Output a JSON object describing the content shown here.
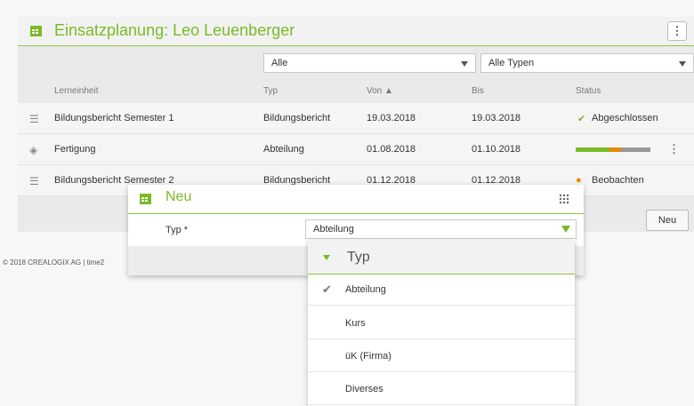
{
  "card": {
    "title": "Einsatzplanung: Leo Leuenberger",
    "menu_icon": "kebab-icon"
  },
  "filters": {
    "typ_filter": "Alle",
    "type_filter": "Alle Typen"
  },
  "columns": [
    "Lerneinheit",
    "Typ",
    "Von ▲",
    "Bis",
    "Status"
  ],
  "rows": [
    {
      "lerneinheit": "Bildungsbericht Semester 1",
      "typ": "Bildungsbericht",
      "von": "19.03.2018",
      "bis": "19.03.2018",
      "status": "Abgeschlossen"
    },
    {
      "lerneinheit": "Fertigung",
      "typ": "Abteilung",
      "von": "01.08.2018",
      "bis": "01.10.2018",
      "status": ""
    },
    {
      "lerneinheit": "Bildungsbericht Semester 2",
      "typ": "Bildungsbericht",
      "von": "01.12.2018",
      "bis": "01.12.2018",
      "status": "Beobachten"
    }
  ],
  "status_progress": {
    "complete": 0.45,
    "warning": 0.15,
    "remaining": 0.4
  },
  "neu_button": "Neu",
  "copyright": "© 2018 CREALOGIX AG  |  time2",
  "dialog": {
    "title": "Neu",
    "field_label": "Typ *",
    "field_value": "Abteilung"
  },
  "dropdown": {
    "title": "Typ",
    "options": [
      "Abteilung",
      "Kurs",
      "üK (Firma)",
      "Diverses"
    ],
    "selected": "Abteilung"
  },
  "colors": {
    "accent": "#7aba28",
    "warning": "#e68a00"
  }
}
